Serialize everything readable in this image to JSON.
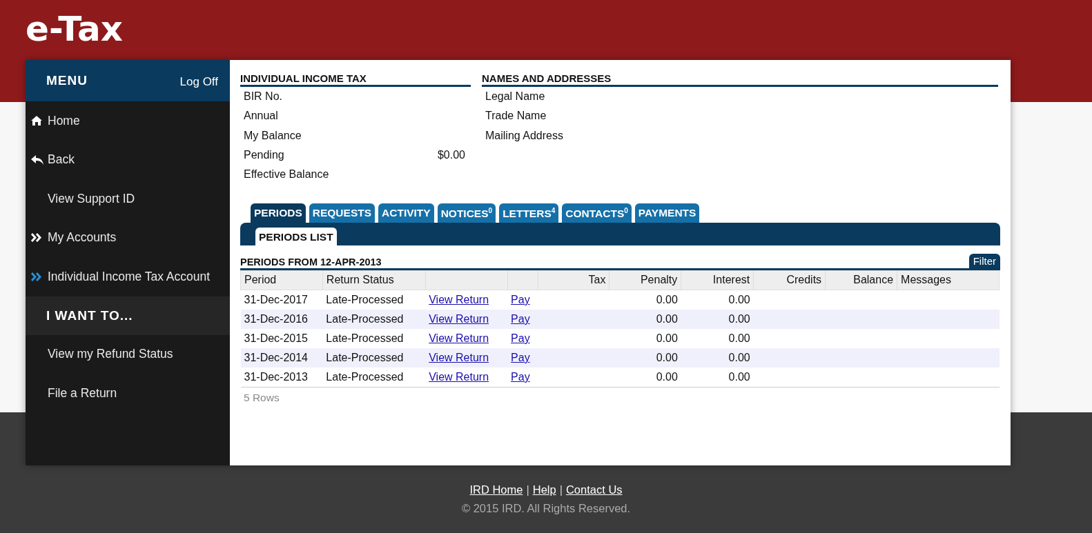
{
  "header": {
    "logo": "e-Tax"
  },
  "menu": {
    "title": "MENU",
    "logoff": "Log Off",
    "items": [
      {
        "label": "Home",
        "kind": "home",
        "selected": false
      },
      {
        "label": "Back",
        "kind": "back",
        "selected": false
      },
      {
        "label": "View Support ID",
        "kind": "plain",
        "selected": false
      },
      {
        "label": "My Accounts",
        "kind": "chevron",
        "selected": false
      },
      {
        "label": "Individual Income Tax Account",
        "kind": "chevron",
        "selected": true
      }
    ],
    "section_title": "I WANT TO...",
    "actions": [
      "View my Refund Status",
      "File a Return"
    ]
  },
  "income_tax": {
    "title": "INDIVIDUAL INCOME TAX",
    "fields": [
      {
        "label": "BIR No."
      },
      {
        "label": "Annual"
      },
      {
        "label": "My Balance"
      },
      {
        "label": "Pending",
        "value": "$0.00"
      },
      {
        "label": "Effective Balance"
      }
    ]
  },
  "names": {
    "title": "NAMES AND ADDRESSES",
    "fields": [
      {
        "label": "Legal Name"
      },
      {
        "label": "Trade Name"
      },
      {
        "label": "Mailing Address"
      }
    ]
  },
  "tabs": [
    {
      "label": "PERIODS",
      "selected": true
    },
    {
      "label": "REQUESTS",
      "selected": false
    },
    {
      "label": "ACTIVITY",
      "selected": false
    },
    {
      "label": "NOTICES",
      "count": "0",
      "selected": false
    },
    {
      "label": "LETTERS",
      "count": "4",
      "selected": false
    },
    {
      "label": "CONTACTS",
      "count": "0",
      "selected": false
    },
    {
      "label": "PAYMENTS",
      "selected": false
    }
  ],
  "subtabs": [
    {
      "label": "PERIODS LIST",
      "selected": true
    }
  ],
  "table": {
    "title": "PERIODS FROM 12-APR-2013",
    "filter": "Filter",
    "columns": [
      "Period",
      "Return Status",
      "",
      "",
      "Tax",
      "Penalty",
      "Interest",
      "Credits",
      "Balance",
      "Messages"
    ],
    "rows": [
      {
        "period": "31-Dec-2017",
        "status": "Late-Processed",
        "view": "View Return",
        "pay": "Pay",
        "penalty": "0.00",
        "interest": "0.00"
      },
      {
        "period": "31-Dec-2016",
        "status": "Late-Processed",
        "view": "View Return",
        "pay": "Pay",
        "penalty": "0.00",
        "interest": "0.00"
      },
      {
        "period": "31-Dec-2015",
        "status": "Late-Processed",
        "view": "View Return",
        "pay": "Pay",
        "penalty": "0.00",
        "interest": "0.00"
      },
      {
        "period": "31-Dec-2014",
        "status": "Late-Processed",
        "view": "View Return",
        "pay": "Pay",
        "penalty": "0.00",
        "interest": "0.00"
      },
      {
        "period": "31-Dec-2013",
        "status": "Late-Processed",
        "view": "View Return",
        "pay": "Pay",
        "penalty": "0.00",
        "interest": "0.00"
      }
    ],
    "row_count": "5 Rows"
  },
  "footer": {
    "links": [
      "IRD Home",
      "Help",
      "Contact Us"
    ],
    "separator": "|",
    "copyright": "© 2015 IRD. All Rights Reserved."
  }
}
